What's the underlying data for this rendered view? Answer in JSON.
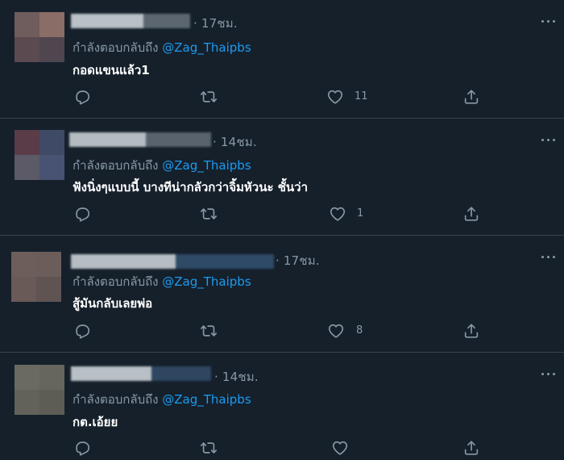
{
  "tweets": [
    {
      "time": "· 17ชม.",
      "reply_prefix": "กำลังตอบกลับถึง ",
      "reply_handle": "@Zag_Thaipbs",
      "text": "กอดแขนแล้ว1",
      "like_count": "11"
    },
    {
      "time": "· 14ชม.",
      "reply_prefix": "กำลังตอบกลับถึง ",
      "reply_handle": "@Zag_Thaipbs",
      "text": "ฟังนิ่งๆแบบนี้ บางทีน่ากลัวกว่าจิ้มหัวนะ ชั้นว่า",
      "like_count": "1"
    },
    {
      "time": "· 17ชม.",
      "reply_prefix": "กำลังตอบกลับถึง ",
      "reply_handle": "@Zag_Thaipbs",
      "text": "สู้มันกลับเลยพ่อ",
      "like_count": "8"
    },
    {
      "time": "· 14ชม.",
      "reply_prefix": "กำลังตอบกลับถึง ",
      "reply_handle": "@Zag_Thaipbs",
      "text": "กต.เอ้ยย",
      "like_count": ""
    }
  ],
  "icons": {
    "reply": "reply-icon",
    "retweet": "retweet-icon",
    "like": "like-icon",
    "share": "share-icon",
    "more": "more-icon"
  },
  "colors": {
    "background": "#15202b",
    "secondary_text": "#8899a6",
    "link": "#1d9bf0",
    "divider": "#38444d"
  }
}
